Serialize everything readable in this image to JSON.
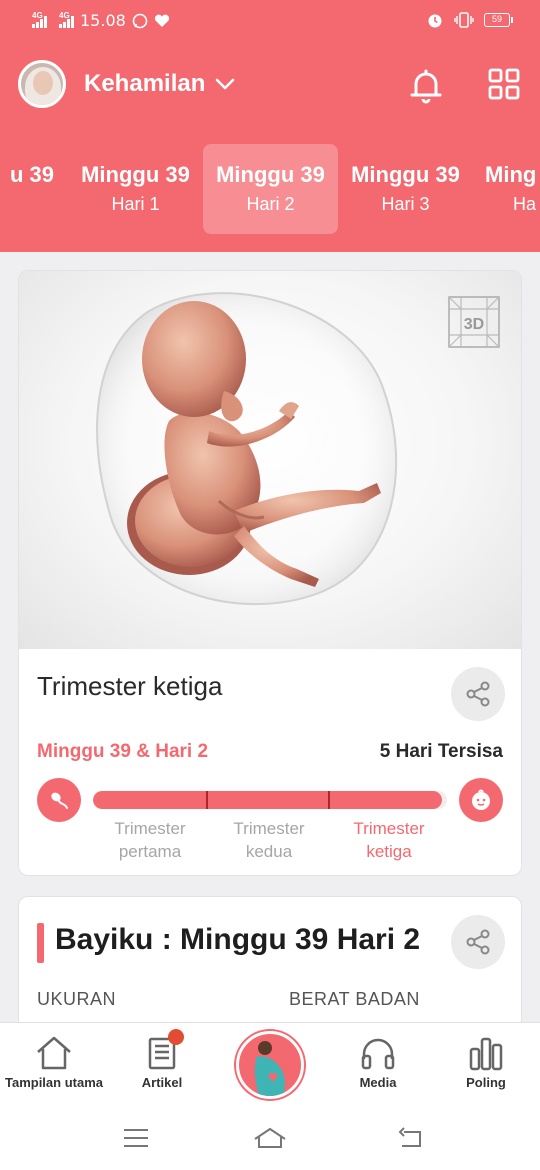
{
  "status_bar": {
    "net1": "4G",
    "net2": "4G",
    "time": "15.08",
    "battery": "59"
  },
  "header": {
    "app_title": "Kehamilan"
  },
  "weeks": [
    {
      "week": "u 39",
      "day": ""
    },
    {
      "week": "Minggu 39",
      "day": "Hari 1"
    },
    {
      "week": "Minggu 39",
      "day": "Hari 2",
      "active": true
    },
    {
      "week": "Minggu 39",
      "day": "Hari 3"
    },
    {
      "week": "Ming",
      "day": "Ha"
    }
  ],
  "hero": {
    "badge": "3D"
  },
  "trimester_card": {
    "title": "Trimester ketiga",
    "current_label": "Minggu 39 & Hari 2",
    "remaining_label": "5 Hari Tersisa",
    "progress": 0.985,
    "stages": [
      {
        "line1": "Trimester",
        "line2": "pertama"
      },
      {
        "line1": "Trimester",
        "line2": "kedua"
      },
      {
        "line1": "Trimester",
        "line2": "ketiga"
      }
    ]
  },
  "baby_card": {
    "title": "Bayiku : Minggu 39 Hari 2",
    "size_label": "UKURAN",
    "weight_label": "BERAT BADAN"
  },
  "bottom_nav": [
    {
      "label": "Tampilan utama",
      "icon": "home-icon"
    },
    {
      "label": "Artikel",
      "icon": "article-icon"
    },
    {
      "label": "",
      "icon": "pregnancy-icon"
    },
    {
      "label": "Media",
      "icon": "headphones-icon"
    },
    {
      "label": "Poling",
      "icon": "poll-icon"
    }
  ],
  "colors": {
    "brand": "#f4696f",
    "notification_dot": "#e34c33"
  }
}
